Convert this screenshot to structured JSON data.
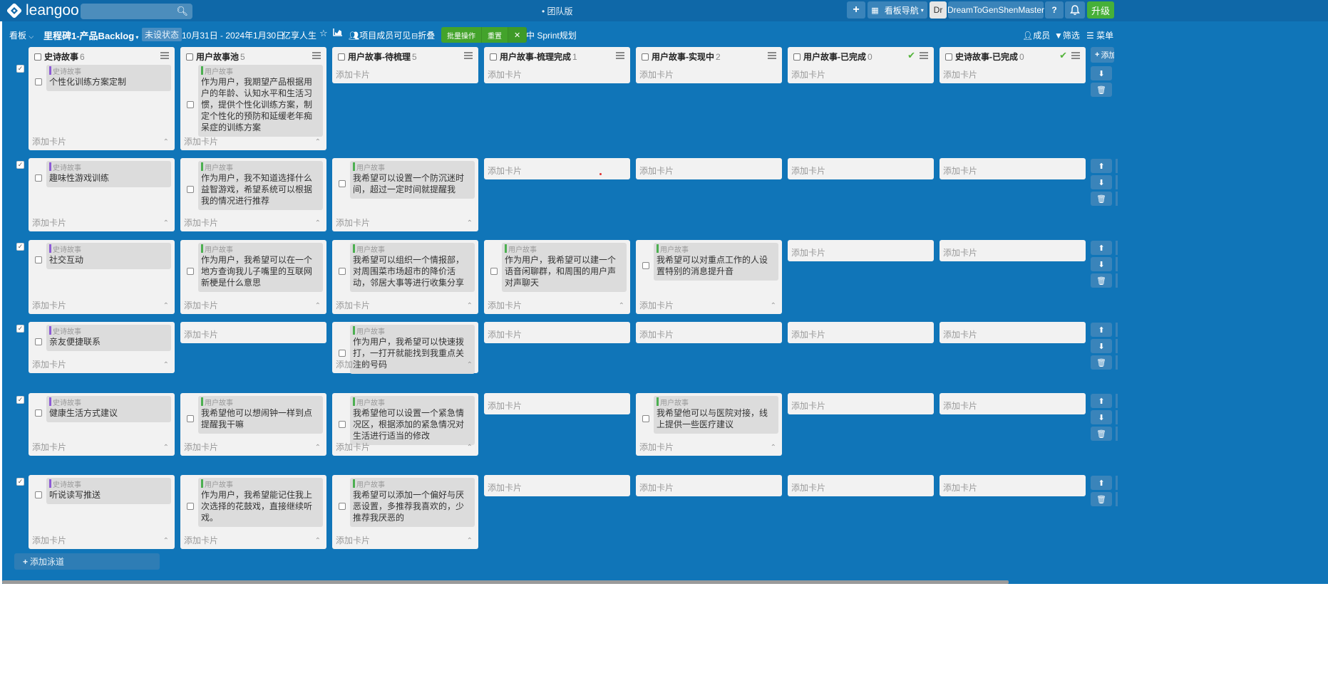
{
  "topbar": {
    "logo": "leangoo",
    "edition": "• 团队版",
    "nav_label": "看板导航",
    "avatar_initials": "Dr",
    "username": "DreamToGenShenMaster",
    "help": "?",
    "upgrade": "升级"
  },
  "subbar": {
    "view": "看板",
    "board_title": "里程碑1-产品Backlog",
    "status": "未设状态",
    "date_range": "10月31日 - 2024年1月30日",
    "owner": "亿享人生",
    "visibility": "项目成员可见",
    "fold": "折叠",
    "batch": "批量操作",
    "reset": "重置",
    "sprint": "Sprint规划",
    "members": "成员",
    "filter": "筛选",
    "menu": "菜单"
  },
  "add_card": "添加卡片",
  "add_lane": "添加泳道",
  "add_column": "添加",
  "columns": [
    {
      "title": "史诗故事",
      "count": "6"
    },
    {
      "title": "用户故事池",
      "count": "5"
    },
    {
      "title": "用户故事-待梳理",
      "count": "5"
    },
    {
      "title": "用户故事-梳理完成",
      "count": "1"
    },
    {
      "title": "用户故事-实现中",
      "count": "2"
    },
    {
      "title": "用户故事-已完成",
      "count": "0"
    },
    {
      "title": "史诗故事-已完成",
      "count": "0"
    }
  ],
  "lanes": [
    {
      "cards": [
        {
          "type": "史诗故事",
          "text": "个性化训练方案定制"
        },
        {
          "type": "用户故事",
          "text": "作为用户，我期望产品根据用户的年龄、认知水平和生活习惯，提供个性化训练方案，制定个性化的预防和延缓老年痴呆症的训练方案"
        },
        null,
        null,
        null,
        null,
        null
      ]
    },
    {
      "cards": [
        {
          "type": "史诗故事",
          "text": "趣味性游戏训练"
        },
        {
          "type": "用户故事",
          "text": "作为用户，我不知道选择什么益智游戏，希望系统可以根据我的情况进行推荐"
        },
        {
          "type": "用户故事",
          "text": "我希望可以设置一个防沉迷时间，超过一定时间就提醒我"
        },
        null,
        null,
        null,
        null
      ]
    },
    {
      "cards": [
        {
          "type": "史诗故事",
          "text": "社交互动"
        },
        {
          "type": "用户故事",
          "text": "作为用户，我希望可以在一个地方查询我儿子嘴里的互联网新梗是什么意思"
        },
        {
          "type": "用户故事",
          "text": "我希望可以组织一个情报部，对周围菜市场超市的降价活动，邻居大事等进行收集分享"
        },
        {
          "type": "用户故事",
          "text": "作为用户，我希望可以建一个语音闲聊群，和周围的用户声对声聊天"
        },
        {
          "type": "用户故事",
          "text": "我希望可以对重点工作的人设置特别的消息提升音"
        },
        null,
        null
      ]
    },
    {
      "cards": [
        {
          "type": "史诗故事",
          "text": "亲友便捷联系"
        },
        null,
        {
          "type": "用户故事",
          "text": "作为用户，我希望可以快速拨打，一打开就能找到我重点关注的号码"
        },
        null,
        null,
        null,
        null
      ]
    },
    {
      "cards": [
        {
          "type": "史诗故事",
          "text": "健康生活方式建议"
        },
        {
          "type": "用户故事",
          "text": "我希望他可以想闹钟一样到点提醒我干嘛"
        },
        {
          "type": "用户故事",
          "text": "我希望他可以设置一个紧急情况区，根据添加的紧急情况对生活进行适当的修改"
        },
        null,
        {
          "type": "用户故事",
          "text": "我希望他可以与医院对接，线上提供一些医疗建议"
        },
        null,
        null
      ]
    },
    {
      "cards": [
        {
          "type": "史诗故事",
          "text": "听说读写推送"
        },
        {
          "type": "用户故事",
          "text": "作为用户，我希望能记住我上次选择的花鼓戏，直接继续听戏。"
        },
        {
          "type": "用户故事",
          "text": "我希望可以添加一个偏好与厌恶设置，多推荐我喜欢的，少推荐我厌恶的"
        },
        null,
        null,
        null,
        null
      ]
    }
  ],
  "colors": {
    "epic": "#8e5bd6",
    "story": "#4caf50",
    "board": "#1075b8",
    "topbar": "#0f68a8"
  }
}
